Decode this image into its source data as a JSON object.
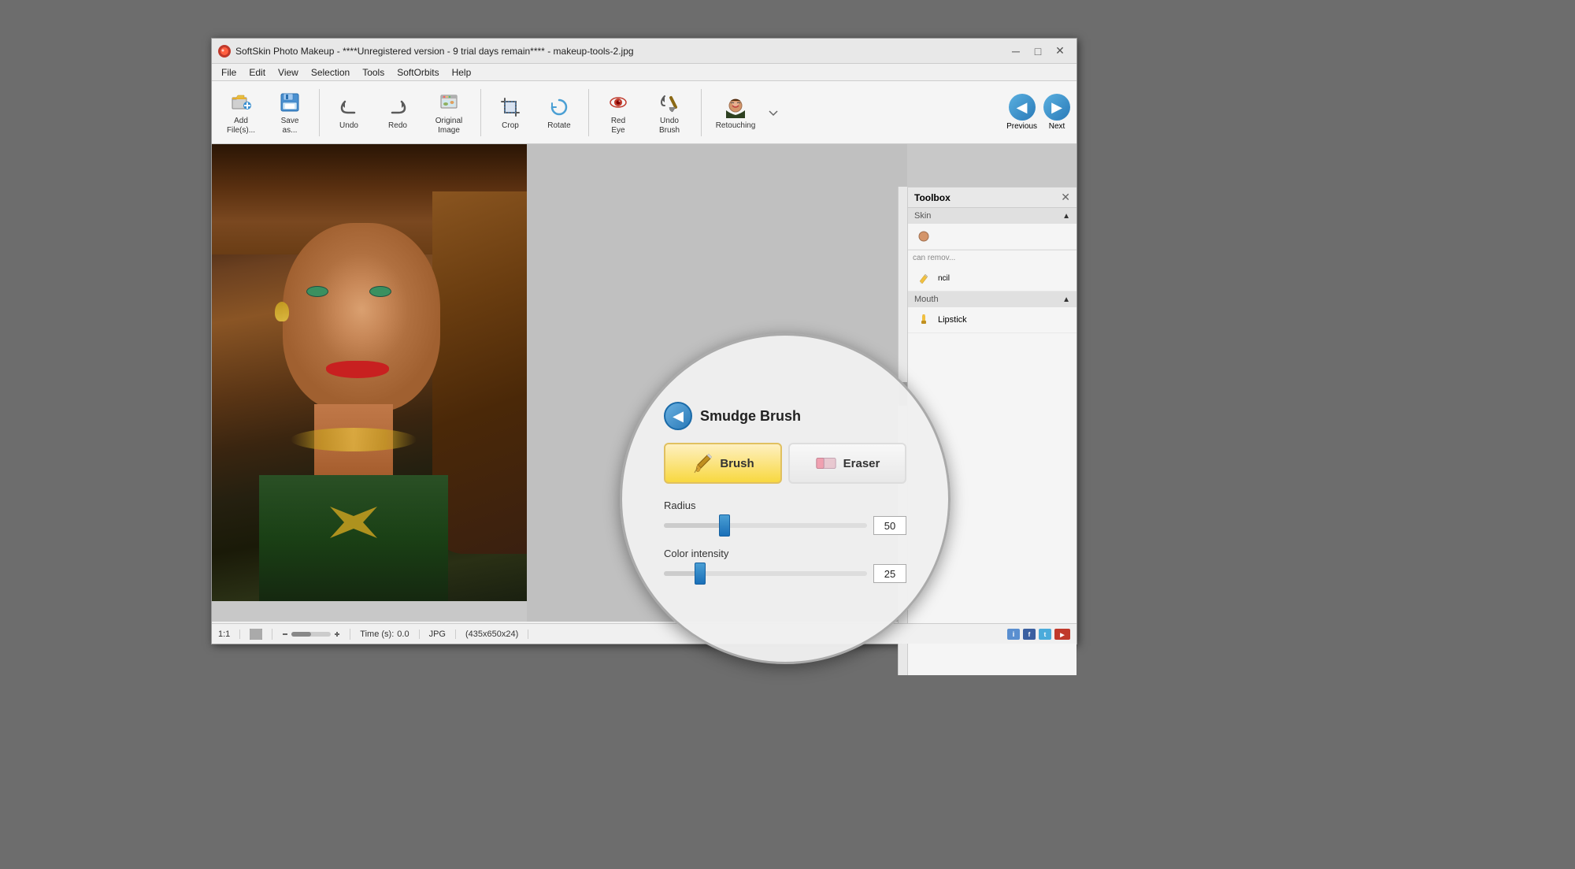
{
  "window": {
    "title": "SoftSkin Photo Makeup - ****Unregistered version - 9 trial days remain**** - makeup-tools-2.jpg",
    "app_name": "SoftSkin Photo Makeup"
  },
  "titlebar": {
    "minimize_label": "─",
    "maximize_label": "□",
    "close_label": "✕"
  },
  "menubar": {
    "items": [
      "File",
      "Edit",
      "View",
      "Selection",
      "Tools",
      "SoftOrbits",
      "Help"
    ]
  },
  "toolbar": {
    "buttons": [
      {
        "id": "add-files",
        "label": "Add\nFile(s)...",
        "icon": "folder"
      },
      {
        "id": "save-as",
        "label": "Save\nas...",
        "icon": "save"
      },
      {
        "id": "undo",
        "label": "Undo",
        "icon": "undo"
      },
      {
        "id": "redo",
        "label": "Redo",
        "icon": "redo"
      },
      {
        "id": "original-image",
        "label": "Original\nImage",
        "icon": "original"
      },
      {
        "id": "crop",
        "label": "Crop",
        "icon": "crop"
      },
      {
        "id": "rotate",
        "label": "Rotate",
        "icon": "rotate"
      },
      {
        "id": "red-eye",
        "label": "Red\nEye",
        "icon": "redeye"
      },
      {
        "id": "undo-brush",
        "label": "Undo\nBrush",
        "icon": "brush"
      },
      {
        "id": "retouching",
        "label": "Retouching",
        "icon": "retouching"
      }
    ]
  },
  "nav": {
    "previous_label": "Previous",
    "next_label": "Next"
  },
  "toolbox": {
    "title": "Toolbox",
    "sections": [
      {
        "id": "skin",
        "label": "Skin",
        "expanded": true
      },
      {
        "id": "mouth",
        "label": "Mouth",
        "expanded": true
      }
    ],
    "items": [
      {
        "id": "lipstick",
        "label": "Lipstick",
        "icon": "pencil"
      }
    ]
  },
  "smudge_brush": {
    "title": "Smudge Brush",
    "brush_label": "Brush",
    "eraser_label": "Eraser",
    "radius_label": "Radius",
    "radius_value": "50",
    "radius_percent": 30,
    "color_intensity_label": "Color intensity",
    "color_intensity_value": "25",
    "color_intensity_percent": 18
  },
  "statusbar": {
    "zoom": "1:1",
    "time_label": "Time (s):",
    "time_value": "0.0",
    "format": "JPG",
    "dimensions": "(435x650x24)"
  },
  "can_remove_text": "can remove...",
  "undo_pencil_label": "pencil"
}
